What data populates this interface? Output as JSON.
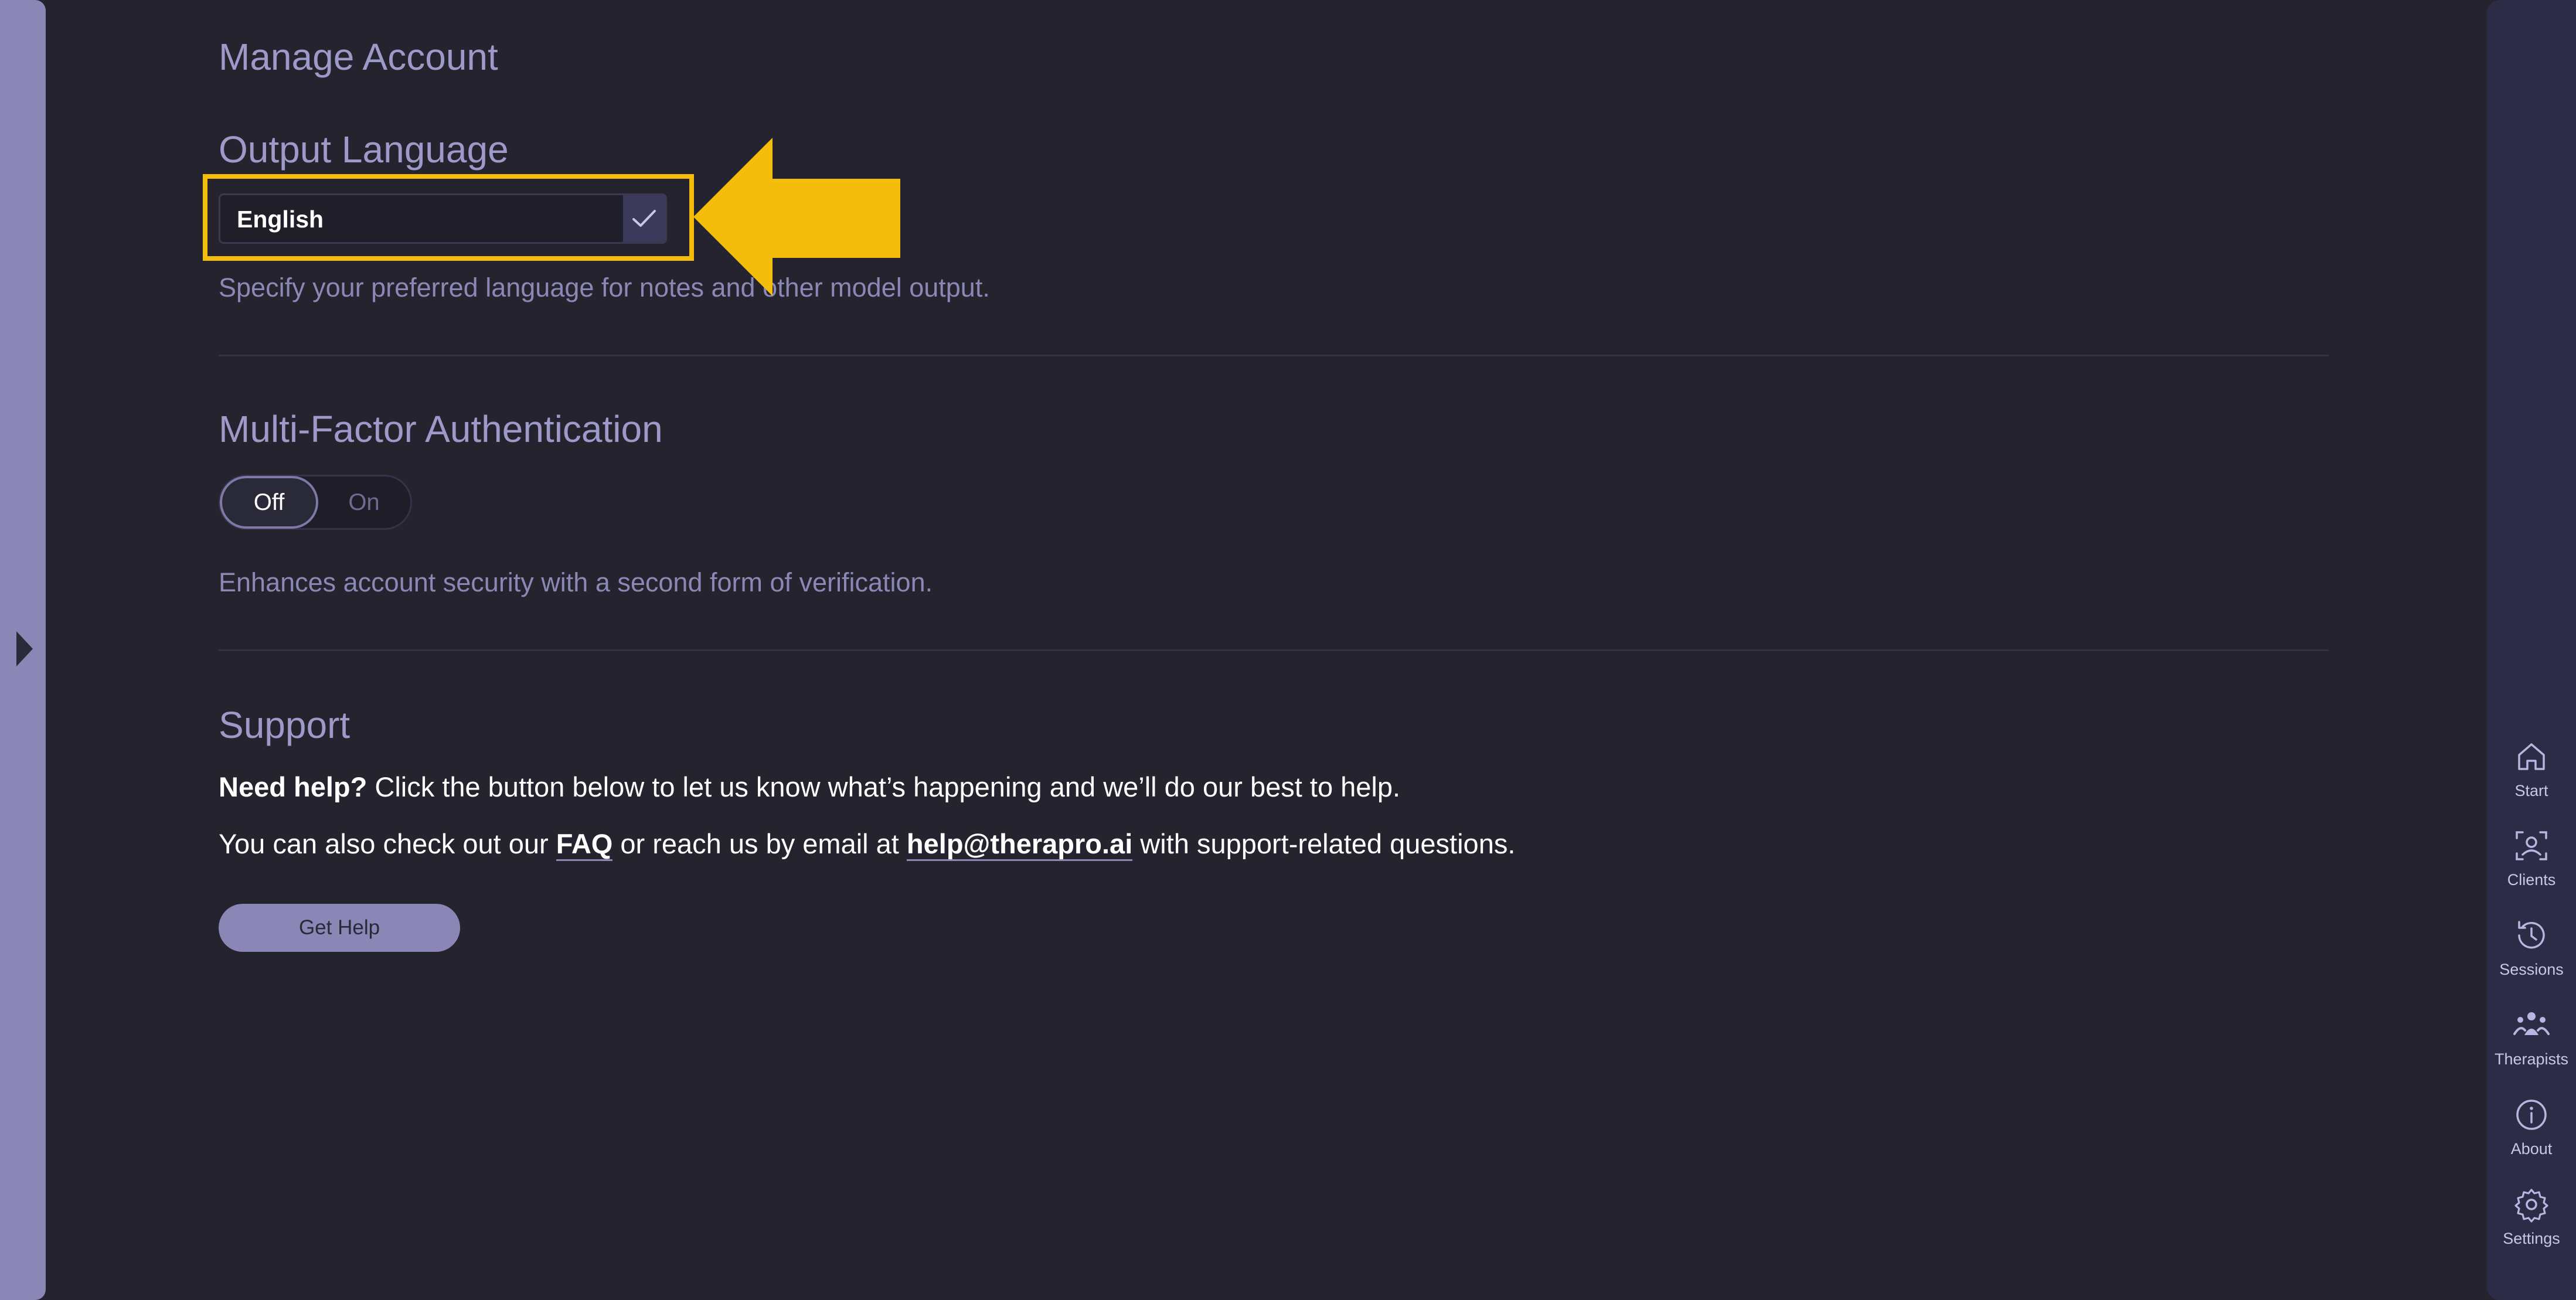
{
  "page": {
    "title": "Manage Account"
  },
  "language": {
    "heading": "Output Language",
    "selected": "English",
    "description": "Specify your preferred language for notes and other model output."
  },
  "mfa": {
    "heading": "Multi-Factor Authentication",
    "off_label": "Off",
    "on_label": "On",
    "selected": "Off",
    "description": "Enhances account security with a second form of verification."
  },
  "support": {
    "heading": "Support",
    "line1_bold": "Need help?",
    "line1_rest": " Click the button below to let us know what’s happening and we’ll do our best to help.",
    "line2_start": "You can also check out our ",
    "faq": "FAQ",
    "line2_mid": " or reach us by email at ",
    "email": "help@therapro.ai",
    "line2_end": " with support-related questions.",
    "button": "Get Help"
  },
  "nav": {
    "items": [
      {
        "label": "Start",
        "icon": "home-icon"
      },
      {
        "label": "Clients",
        "icon": "clients-icon"
      },
      {
        "label": "Sessions",
        "icon": "history-icon"
      },
      {
        "label": "Therapists",
        "icon": "therapists-icon"
      },
      {
        "label": "About",
        "icon": "info-icon"
      },
      {
        "label": "Settings",
        "icon": "gear-icon"
      }
    ]
  },
  "colors": {
    "background": "#24232e",
    "accent": "#8a86b6",
    "highlight": "#f5bd0b"
  }
}
